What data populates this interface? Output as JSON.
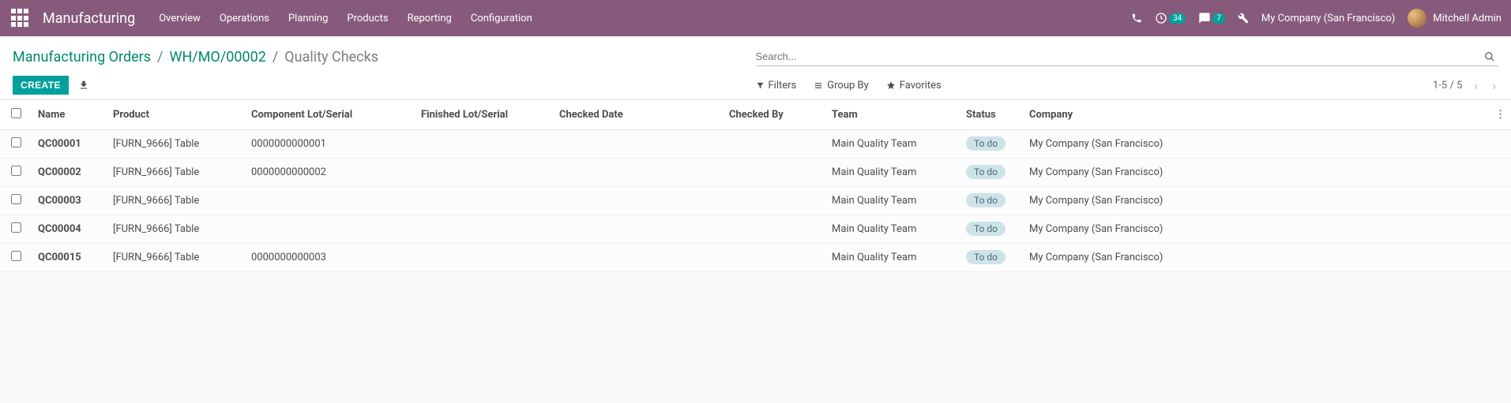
{
  "navbar": {
    "app_title": "Manufacturing",
    "menu": [
      "Overview",
      "Operations",
      "Planning",
      "Products",
      "Reporting",
      "Configuration"
    ],
    "activities_count": "34",
    "messages_count": "7",
    "company": "My Company (San Francisco)",
    "user": "Mitchell Admin"
  },
  "breadcrumb": {
    "items": [
      "Manufacturing Orders",
      "WH/MO/00002"
    ],
    "current": "Quality Checks"
  },
  "search": {
    "placeholder": "Search..."
  },
  "buttons": {
    "create": "Create"
  },
  "search_options": {
    "filters": "Filters",
    "groupby": "Group By",
    "favorites": "Favorites"
  },
  "pager": {
    "range": "1-5",
    "total": "5"
  },
  "table": {
    "headers": [
      "Name",
      "Product",
      "Component Lot/Serial",
      "Finished Lot/Serial",
      "Checked Date",
      "Checked By",
      "Team",
      "Status",
      "Company"
    ],
    "rows": [
      {
        "name": "QC00001",
        "product": "[FURN_9666] Table",
        "component_lot": "0000000000001",
        "finished_lot": "",
        "checked_date": "",
        "checked_by": "",
        "team": "Main Quality Team",
        "status": "To do",
        "company": "My Company (San Francisco)"
      },
      {
        "name": "QC00002",
        "product": "[FURN_9666] Table",
        "component_lot": "0000000000002",
        "finished_lot": "",
        "checked_date": "",
        "checked_by": "",
        "team": "Main Quality Team",
        "status": "To do",
        "company": "My Company (San Francisco)"
      },
      {
        "name": "QC00003",
        "product": "[FURN_9666] Table",
        "component_lot": "",
        "finished_lot": "",
        "checked_date": "",
        "checked_by": "",
        "team": "Main Quality Team",
        "status": "To do",
        "company": "My Company (San Francisco)"
      },
      {
        "name": "QC00004",
        "product": "[FURN_9666] Table",
        "component_lot": "",
        "finished_lot": "",
        "checked_date": "",
        "checked_by": "",
        "team": "Main Quality Team",
        "status": "To do",
        "company": "My Company (San Francisco)"
      },
      {
        "name": "QC00015",
        "product": "[FURN_9666] Table",
        "component_lot": "0000000000003",
        "finished_lot": "",
        "checked_date": "",
        "checked_by": "",
        "team": "Main Quality Team",
        "status": "To do",
        "company": "My Company (San Francisco)"
      }
    ]
  }
}
